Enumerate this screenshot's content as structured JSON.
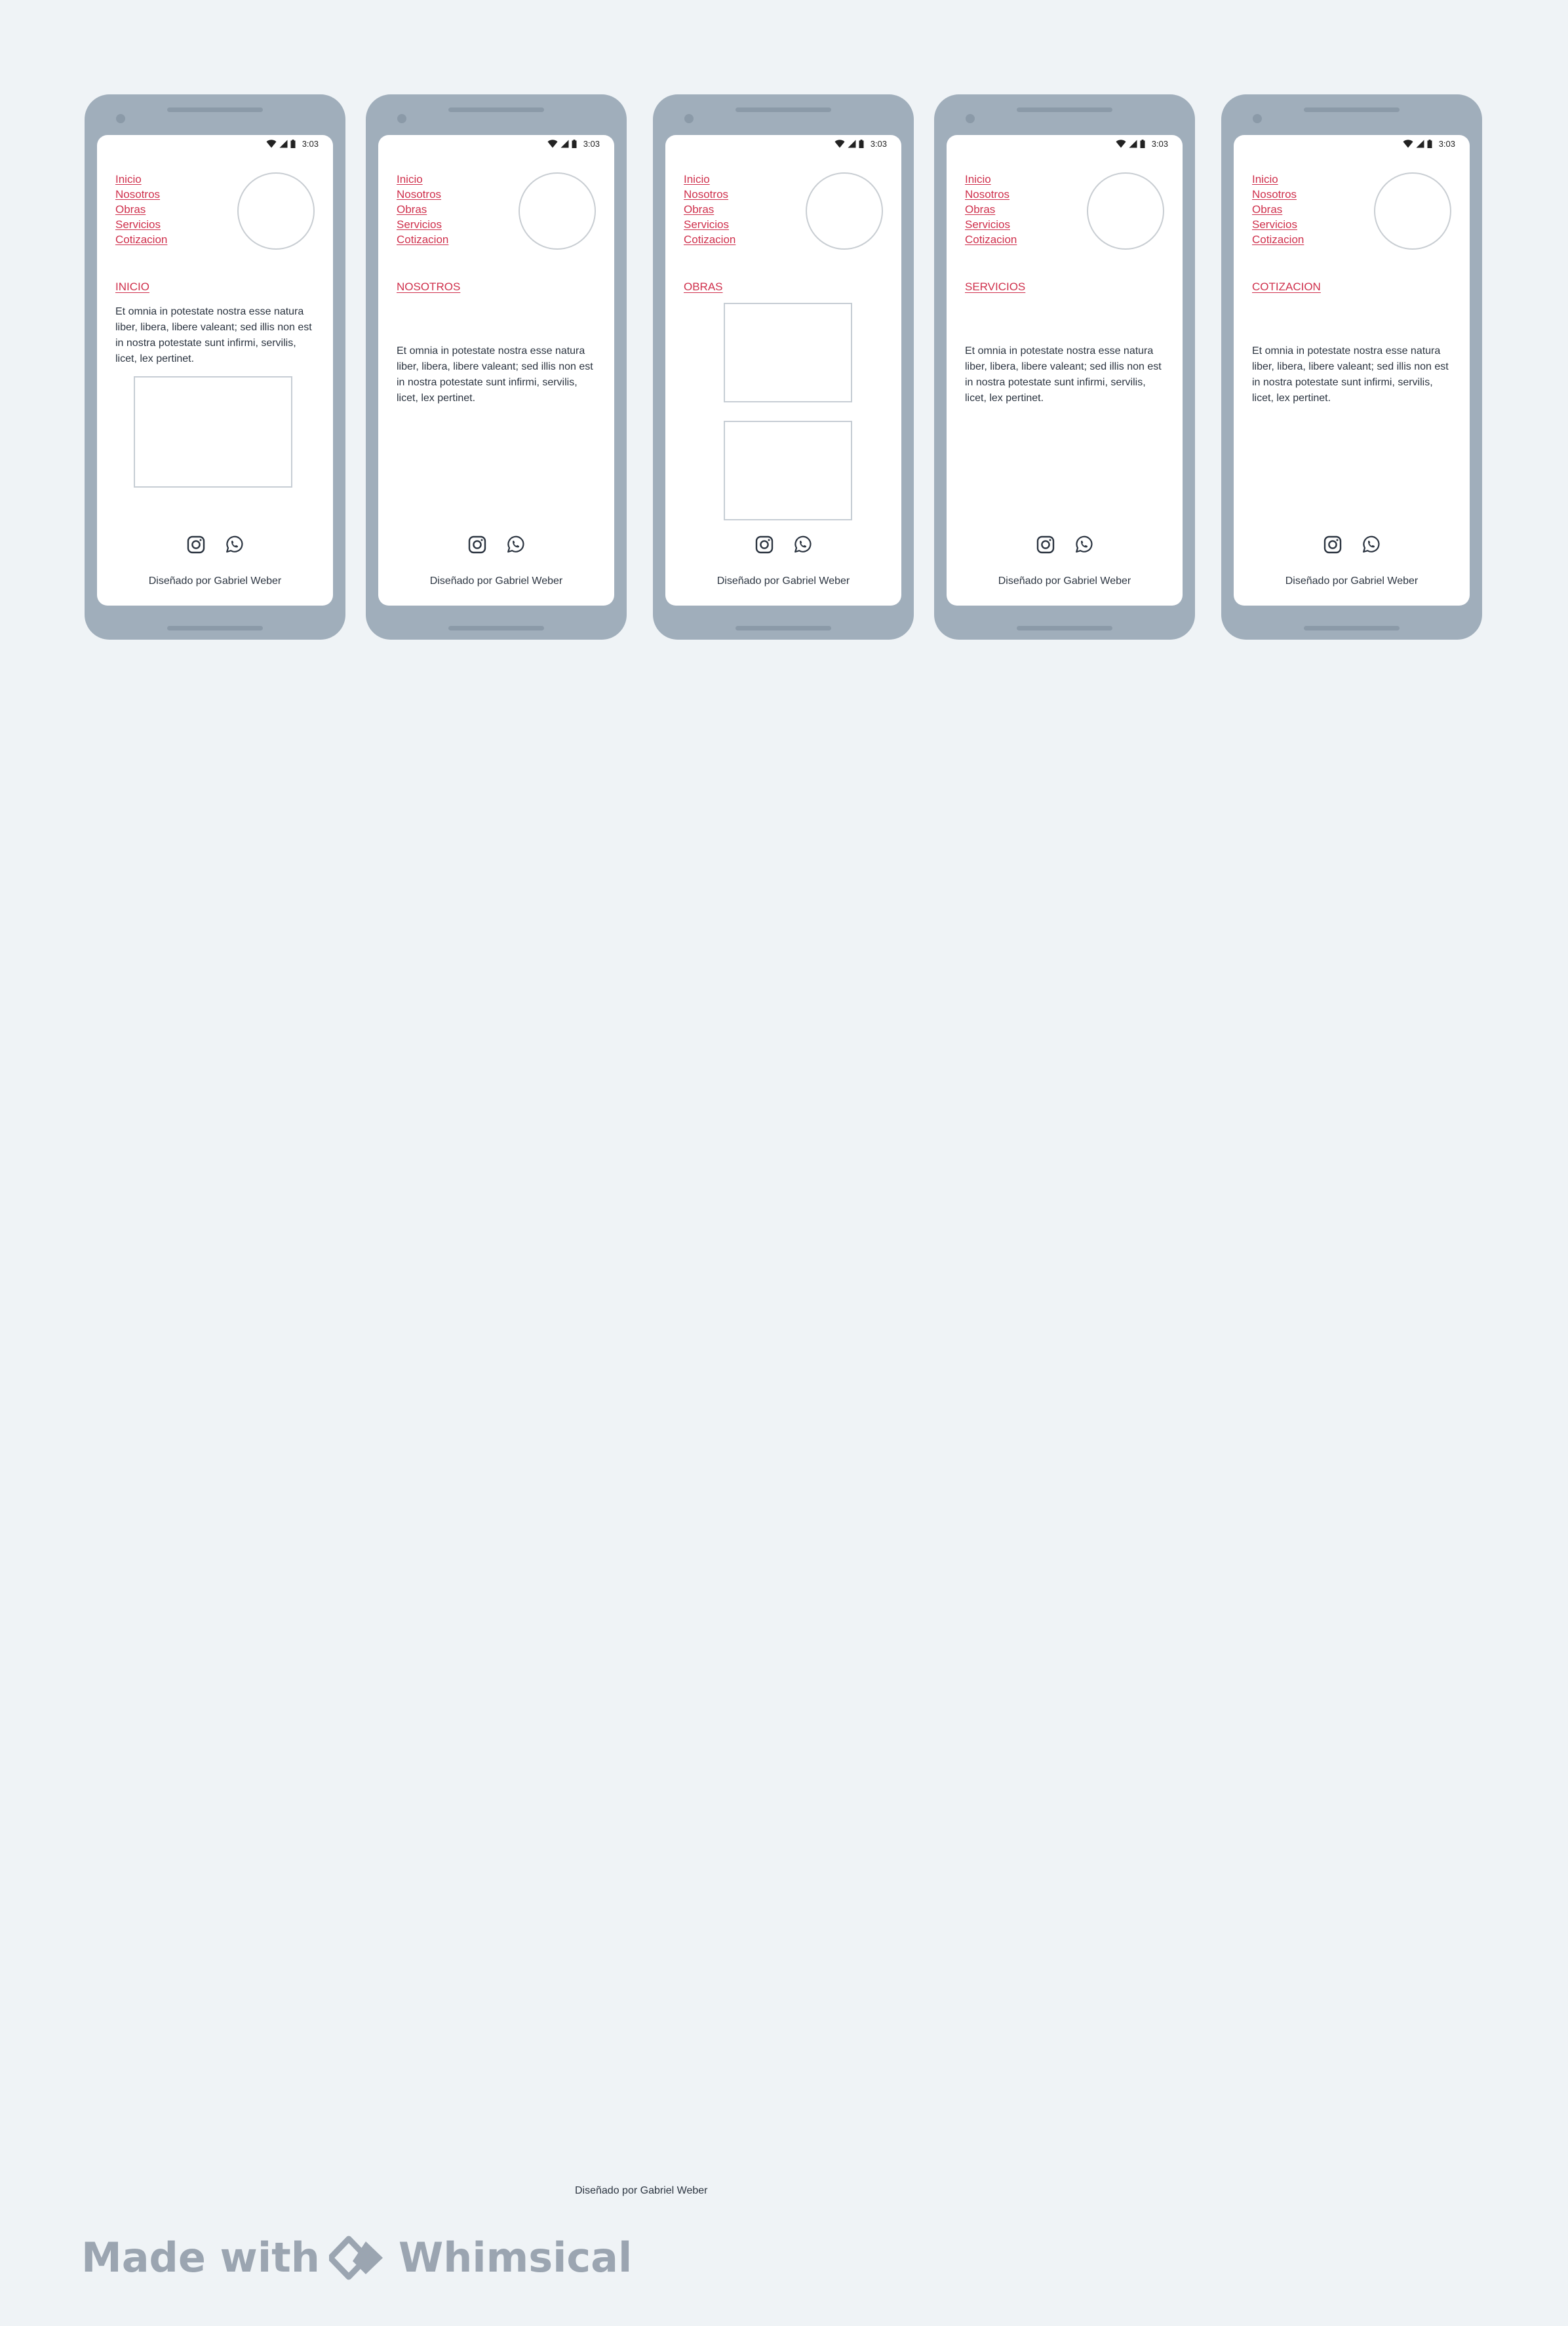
{
  "status_bar": {
    "time": "3:03"
  },
  "nav": {
    "items": [
      "Inicio",
      "Nosotros",
      "Obras",
      "Servicios",
      "Cotizacion"
    ]
  },
  "screens": [
    {
      "section_title": "INICIO",
      "body": "Et omnia in potestate nostra esse natura liber, libera, libere valeant; sed illis non est in nostra potestate sunt infirmi, servilis, licet, lex pertinet."
    },
    {
      "section_title": "NOSOTROS",
      "body": "Et omnia in potestate nostra esse natura liber, libera, libere valeant; sed illis non est in nostra potestate sunt infirmi, servilis, licet, lex pertinet."
    },
    {
      "section_title": "OBRAS"
    },
    {
      "section_title": "SERVICIOS",
      "body": "Et omnia in potestate nostra esse natura liber, libera, libere valeant; sed illis non est in nostra potestate sunt infirmi, servilis, licet, lex pertinet."
    },
    {
      "section_title": "COTIZACION",
      "body": "Et omnia in potestate nostra esse natura liber, libera, libere valeant; sed illis non est in nostra potestate sunt infirmi, servilis, licet, lex pertinet."
    }
  ],
  "footer": {
    "credit": "Diseñado por Gabriel Weber",
    "icons": [
      "instagram-icon",
      "whatsapp-icon"
    ]
  },
  "page_credit": "Diseñado por Gabriel Weber",
  "watermark": {
    "prefix": "Made with",
    "brand": "Whimsical"
  },
  "colors": {
    "background": "#eff3f6",
    "phone_frame": "#a0aebb",
    "link": "#cf2f4b",
    "text": "#2b3440",
    "watermark": "#9ba5b1"
  }
}
